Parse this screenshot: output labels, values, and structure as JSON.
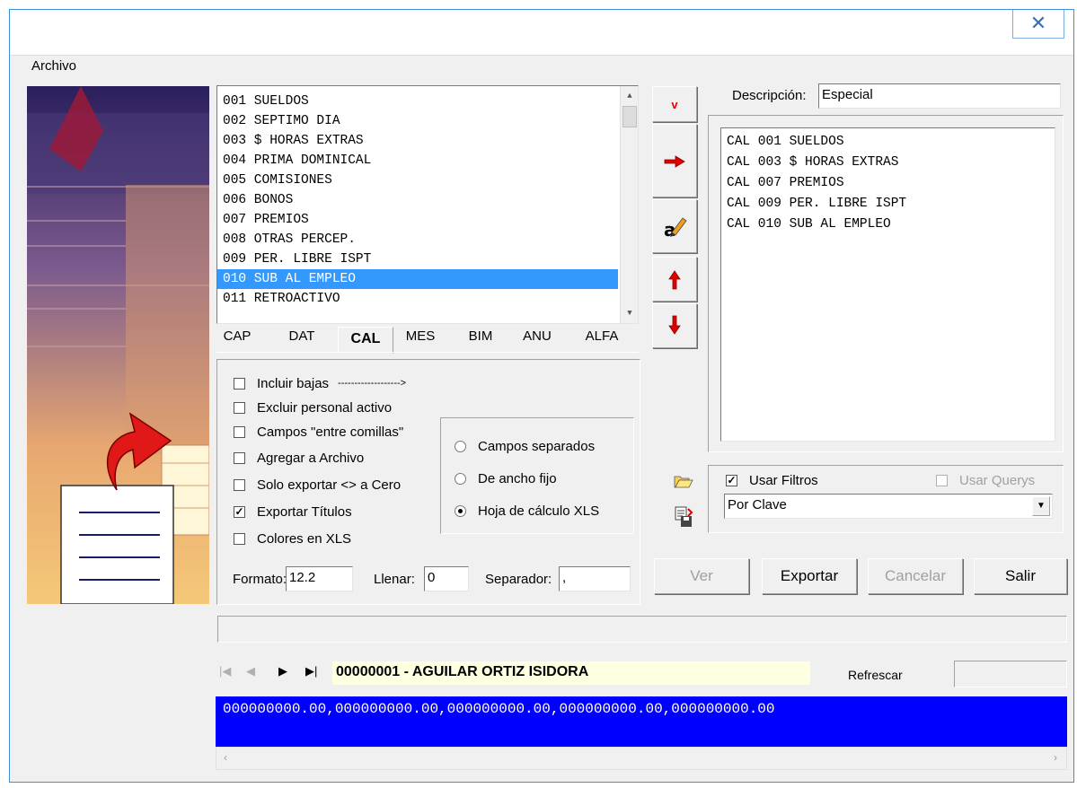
{
  "window": {
    "close_glyph": "✕"
  },
  "menu": {
    "archivo": "Archivo"
  },
  "fields_list": [
    "001 SUELDOS",
    "002 SEPTIMO DIA",
    "003 $ HORAS EXTRAS",
    "004 PRIMA DOMINICAL",
    "005 COMISIONES",
    "006 BONOS",
    "007 PREMIOS",
    "008 OTRAS PERCEP.",
    "009 PER. LIBRE ISPT",
    "010 SUB AL EMPLEO",
    "011 RETROACTIVO"
  ],
  "fields_selected_index": 9,
  "tabs": [
    "CAP",
    "DAT",
    "CAL",
    "MES",
    "BIM",
    "ANU",
    "ALFA"
  ],
  "active_tab": "CAL",
  "options": {
    "incluir_bajas": "Incluir bajas",
    "incluir_bajas_arrow": "------------------->",
    "excluir_activo": "Excluir personal activo",
    "campos_comillas": "Campos \"entre comillas\"",
    "agregar_archivo": "Agregar a Archivo",
    "solo_exportar": "Solo exportar <> a Cero",
    "exportar_titulos": "Exportar Títulos",
    "colores_xls": "Colores en XLS"
  },
  "format_options": {
    "campos_separados": "Campos separados",
    "ancho_fijo": "De ancho fijo",
    "hoja_xls": "Hoja de cálculo XLS"
  },
  "formato": {
    "label": "Formato:",
    "value": "12.2"
  },
  "llenar": {
    "label": "Llenar:",
    "value": "0"
  },
  "separador": {
    "label": "Separador:",
    "value": ","
  },
  "descripcion": {
    "label": "Descripción:",
    "value": "Especial"
  },
  "selected_list": [
    "CAL 001 SUELDOS",
    "CAL 003 $ HORAS EXTRAS",
    "CAL 007 PREMIOS",
    "CAL 009 PER. LIBRE ISPT",
    "CAL 010 SUB AL EMPLEO"
  ],
  "filters": {
    "usar_filtros": "Usar Filtros",
    "usar_querys": "Usar Querys",
    "order_value": "Por Clave"
  },
  "buttons": {
    "ver": "Ver",
    "exportar": "Exportar",
    "cancelar": "Cancelar",
    "salir": "Salir"
  },
  "record": {
    "current": "00000001 - AGUILAR ORTIZ ISIDORA",
    "refrescar": "Refrescar"
  },
  "output_preview": "000000000.00,000000000.00,000000000.00,000000000.00,000000000.00",
  "colors": {
    "selection": "#3399ff",
    "output_bg": "#0000ff",
    "record_bg": "#ffffe1",
    "window_border": "#3c8fd8"
  }
}
